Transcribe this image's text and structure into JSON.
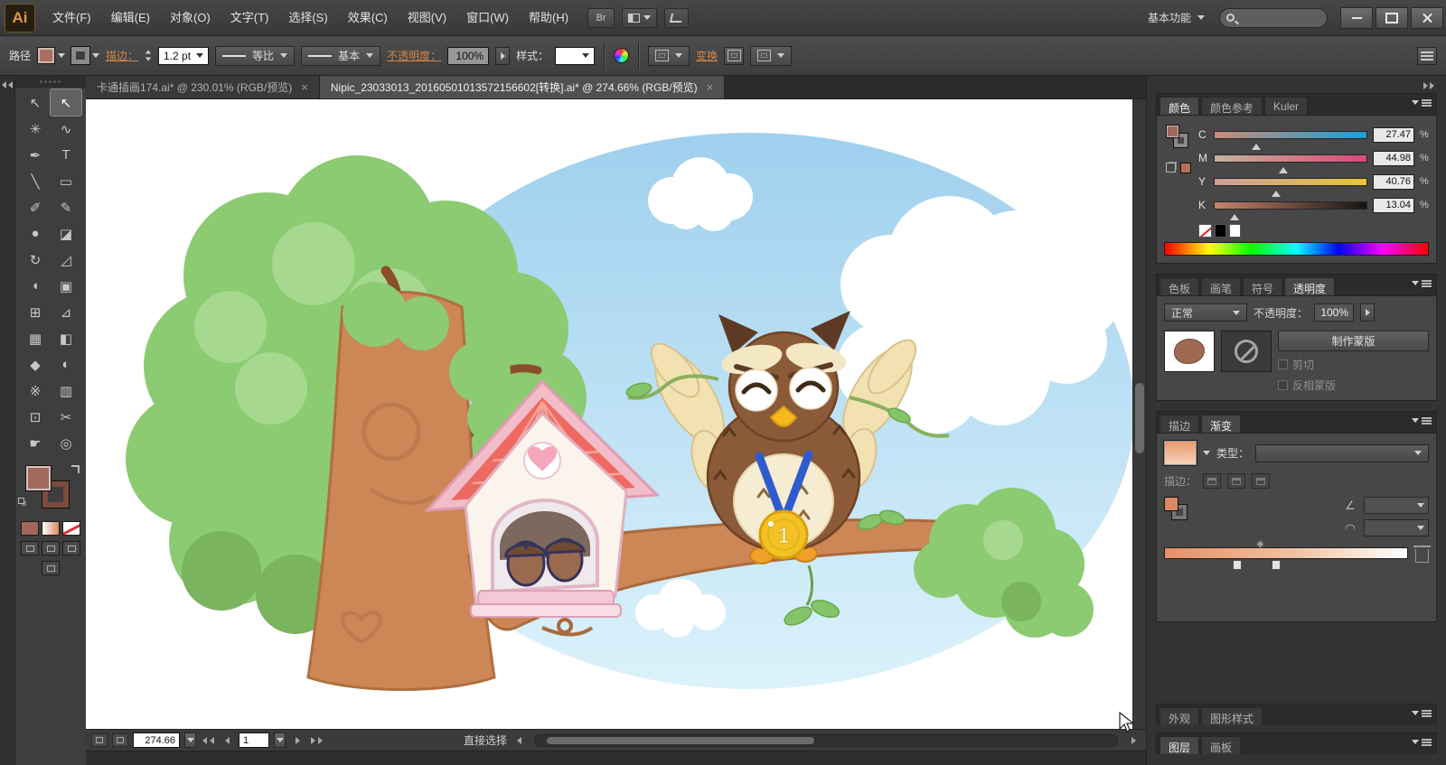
{
  "colors": {
    "accent_link": "#d1884b",
    "ui_background": "#3c3c3c",
    "panel_background": "#474747",
    "canvas_background": "#ffffff",
    "sky_blue": "#aed9f3",
    "tree_green": "#8ccb71",
    "trunk_brown": "#cd8656",
    "owl_brown": "#8b5a38",
    "owl_cream": "#f2e2b2",
    "roof_red": "#ee6a60",
    "roof_pink": "#f3bcc9",
    "medal_gold": "#f3c125",
    "ribbon_blue": "#2f5bd0",
    "current_fill": "#a2685c"
  },
  "menubar": {
    "logo": "Ai",
    "items": [
      "文件(F)",
      "编辑(E)",
      "对象(O)",
      "文字(T)",
      "选择(S)",
      "效果(C)",
      "视图(V)",
      "窗口(W)",
      "帮助(H)"
    ],
    "br_label": "Br",
    "workspace_label": "基本功能"
  },
  "control_bar": {
    "selection_type_label": "路径",
    "stroke_link": "描边：",
    "stroke_width_value": "1.2 pt",
    "width_profile_value": "等比",
    "brush_definition_value": "基本",
    "opacity_link": "不透明度：",
    "opacity_value": "100%",
    "style_label": "样式：",
    "transform_link": "变换"
  },
  "document_tabs": [
    {
      "title": "卡通插画174.ai* @ 230.01% (RGB/预览)",
      "close_glyph": "×"
    },
    {
      "title": "Nipic_23033013_20160501013572156602[转换].ai* @ 274.66% (RGB/预览)",
      "close_glyph": "×"
    }
  ],
  "toolbar": {
    "tools": [
      {
        "name": "selection-tool",
        "glyph": "↖"
      },
      {
        "name": "direct-selection-tool",
        "glyph": "↖"
      },
      {
        "name": "magic-wand-tool",
        "glyph": "✳"
      },
      {
        "name": "lasso-tool",
        "glyph": "∿"
      },
      {
        "name": "pen-tool",
        "glyph": "✒"
      },
      {
        "name": "type-tool",
        "glyph": "T"
      },
      {
        "name": "line-segment-tool",
        "glyph": "╲"
      },
      {
        "name": "rectangle-tool",
        "glyph": "▭"
      },
      {
        "name": "paintbrush-tool",
        "glyph": "✐"
      },
      {
        "name": "pencil-tool",
        "glyph": "✎"
      },
      {
        "name": "blob-brush-tool",
        "glyph": "●"
      },
      {
        "name": "eraser-tool",
        "glyph": "◪"
      },
      {
        "name": "rotate-tool",
        "glyph": "↻"
      },
      {
        "name": "scale-tool",
        "glyph": "◿"
      },
      {
        "name": "width-tool",
        "glyph": "◖"
      },
      {
        "name": "free-transform-tool",
        "glyph": "▣"
      },
      {
        "name": "shape-builder-tool",
        "glyph": "⊞"
      },
      {
        "name": "perspective-grid-tool",
        "glyph": "⊿"
      },
      {
        "name": "mesh-tool",
        "glyph": "▦"
      },
      {
        "name": "gradient-tool",
        "glyph": "◧"
      },
      {
        "name": "eyedropper-tool",
        "glyph": "◆"
      },
      {
        "name": "blend-tool",
        "glyph": "◐"
      },
      {
        "name": "symbol-sprayer-tool",
        "glyph": "※"
      },
      {
        "name": "column-graph-tool",
        "glyph": "▥"
      },
      {
        "name": "artboard-tool",
        "glyph": "⊡"
      },
      {
        "name": "slice-tool",
        "glyph": "✂"
      },
      {
        "name": "hand-tool",
        "glyph": "☛"
      },
      {
        "name": "zoom-tool",
        "glyph": "◎"
      }
    ]
  },
  "status_bar": {
    "zoom_value": "274.66",
    "artboard_value": "1",
    "tool_name": "直接选择"
  },
  "color_panel": {
    "tabs": [
      "颜色",
      "颜色参考",
      "Kuler"
    ],
    "sliders": [
      {
        "channel": "C",
        "value": "27.47",
        "unit": "%"
      },
      {
        "channel": "M",
        "value": "44.98",
        "unit": "%"
      },
      {
        "channel": "Y",
        "value": "40.76",
        "unit": "%"
      },
      {
        "channel": "K",
        "value": "13.04",
        "unit": "%"
      }
    ]
  },
  "swatch_group_tabs": [
    "色板",
    "画笔",
    "符号",
    "透明度"
  ],
  "transparency_panel": {
    "blend_mode_value": "正常",
    "opacity_label": "不透明度：",
    "opacity_value": "100%",
    "make_mask_label": "制作蒙版",
    "clip_label": "剪切",
    "invert_mask_label": "反相蒙版"
  },
  "stroke_gradient_tabs": [
    "描边",
    "渐变"
  ],
  "gradient_panel": {
    "type_label": "类型：",
    "stroke_label": "描边：",
    "angle_icon": "∠",
    "aspect_icon": "◠"
  },
  "bottom_panel_tabs": {
    "appearance": "外观",
    "graphic_styles": "图形样式",
    "layers": "图层",
    "artboards": "画板"
  },
  "canvas": {
    "medal_text": "1"
  }
}
